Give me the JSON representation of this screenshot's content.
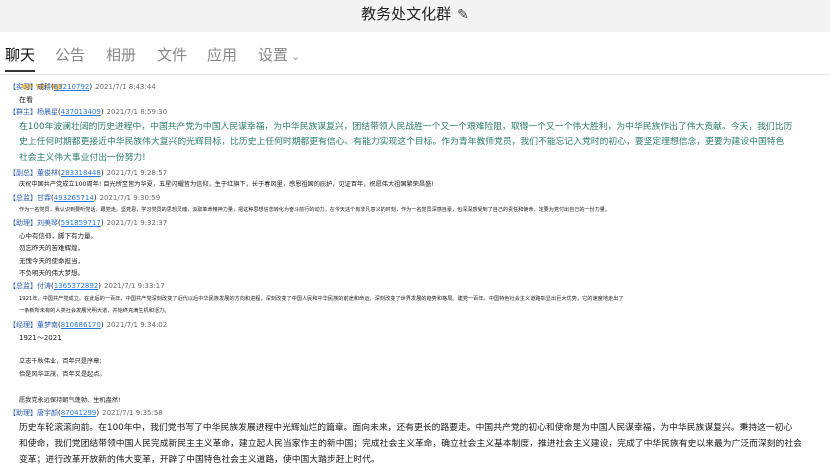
{
  "window": {
    "title": "教务处文化群"
  },
  "tabs": [
    {
      "label": "聊天"
    },
    {
      "label": "公告"
    },
    {
      "label": "相册"
    },
    {
      "label": "文件"
    },
    {
      "label": "应用"
    },
    {
      "label": "设置"
    }
  ],
  "messages": [
    {
      "badge": "【实习】",
      "name": "成耕",
      "qq": "63210792",
      "time": "2021/7/1 8:43:44",
      "lines": [
        "在看"
      ]
    },
    {
      "badge": "【群主】",
      "name": "杨晨星",
      "qq": "437013409",
      "time": "2021/7/1 8:59:30",
      "lines": [
        "在100年波澜壮阔的历史进程中，中国共产党为中国人民谋幸福，为中华民族谋复兴，团结带领人民战胜一个又一个艰难险阻，取得一个又一个伟大胜利，为中华民族作出了伟大贡献。今天，我们比历",
        "史上任何时期都更接近中华民族伟大复兴的光辉目标，比历史上任何时期都更有信心、有能力实现这个目标。作为青年教师党员，我们不能忘记入党时的初心，要坚定理想信念，更要为建设中国特色",
        "社会主义伟大事业付出一份努力!"
      ]
    },
    {
      "badge": "【副总】",
      "name": "董俊林",
      "qq": "283318448",
      "time": "2021/7/1 9:28:57",
      "lines": [
        "庆祝中国共产党成立100周年! 目光所至皆为华夏，五星闪耀皆为信仰，生于红旗下，长于春风里，感恩祖国的庇护，见证百年，祝愿伟大祖国繁荣昌盛!"
      ]
    },
    {
      "badge": "【总监】",
      "name": "甘霖",
      "qq": "493265714",
      "time": "2021/7/1 9:30:59",
      "lines": [
        "作为一名党员，我认识到要听党话、跟党走，坚党恩，学习党员的思想灵魂，汲取革命精神力量，把这种思想信念转化为奋斗前行的动力。在今天这个有非凡意义的时刻，作为一名党员深感自豪，也深深感受到了自己的责任和使命，定要为党付出自己的一份力量。"
      ]
    },
    {
      "badge": "【助理】",
      "name": "刘美琴",
      "qq": "591859717",
      "time": "2021/7/1 9:32:37",
      "lines": [
        "心中有信仰，脚下有力量。",
        "勿忘昨天的苦难辉煌，",
        "无愧今天的使命担当，",
        "不负明天的伟大梦想。"
      ]
    },
    {
      "badge": "【总监】",
      "name": "付涛",
      "qq": "1365372892",
      "time": "2021/7/1 9:33:17",
      "lines": [
        "1921年，中国共产党成立。在此后的一百年，中国共产党深刻改变了近代以后中华民族发展的方向和进程，深刻改变了中国人民和中华民族的前途和命运，深刻改变了世界发展的趋势和格局。建党一百年，中国特色社会主义道路彰显出巨大优势，它的速度地走出了",
        "一条新所未有的人类社会发展光明大道，并始终充满生机和活力。"
      ]
    },
    {
      "badge": "【经理】",
      "name": "董梦南",
      "qq": "810686170",
      "time": "2021/7/1 9:34:02",
      "lines": [
        "1921～2021",
        "",
        "立志千秋伟业，百年只是序章;",
        "恰是风华正茂，百年又是起点。",
        "",
        "愿我党永远保持朝气蓬勃、生机盎然!"
      ]
    },
    {
      "badge": "【助理】",
      "name": "唐宇颜",
      "qq": "87041299",
      "time": "2021/7/1 9:35:58",
      "lines": [
        "历史车轮滚滚向前。在100年中，我们党书写了中华民族发展进程中光辉灿烂的篇章。面向未来，还有更长的路要走。中国共产党的初心和使命是为中国人民谋幸福，为中华民族谋复兴。秉持这一初心",
        "和使命，我们党团结带领中国人民完成新民主主义革命，建立起人民当家作主的新中国；完成社会主义革命，确立社会主义基本制度，推进社会主义建设，完成了中华民族有史以来最为广泛而深刻的社会",
        "变革；进行改革开放新的伟大变革，开辟了中国特色社会主义道路，使中国大踏步赶上时代。"
      ]
    }
  ]
}
